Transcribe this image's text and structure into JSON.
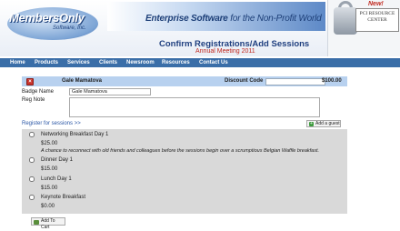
{
  "header": {
    "logo_name": "MembersOnly",
    "logo_inc": "Software, Inc.",
    "tagline_bold": "Enterprise Software",
    "tagline_rest": " for the Non-Profit World",
    "page_title": "Confirm Registrations/Add Sessions",
    "event_name": "Annual Meeting 2011"
  },
  "pci": {
    "new": "New!",
    "line1": "PCI RESOURCE",
    "line2": "CENTER"
  },
  "nav": [
    "Home",
    "Products",
    "Services",
    "Clients",
    "Newsroom",
    "Resources",
    "Contact Us"
  ],
  "registrant": {
    "name": "Gale Mamatova",
    "discount_label": "Discount Code",
    "discount_value": "",
    "amount": "$100.00",
    "badge_label": "Badge Name",
    "badge_value": "Gale Mamatova",
    "note_label": "Reg Note",
    "note_value": ""
  },
  "register_link": "Register for sessions >>",
  "add_guest_label": "Add a guest",
  "sessions": [
    {
      "name": "Networking Breakfast Day 1",
      "price": "$25.00",
      "description": "A chance to reconnect with old friends and colleagues before the sessions begin over a scrumptious Belgian Waffle breakfast."
    },
    {
      "name": "Dinner Day 1",
      "price": "$15.00",
      "description": ""
    },
    {
      "name": "Lunch Day 1",
      "price": "$15.00",
      "description": ""
    },
    {
      "name": "Keynote Breakfast",
      "price": "$0.00",
      "description": ""
    }
  ],
  "add_to_cart_label": "Add To Cart"
}
